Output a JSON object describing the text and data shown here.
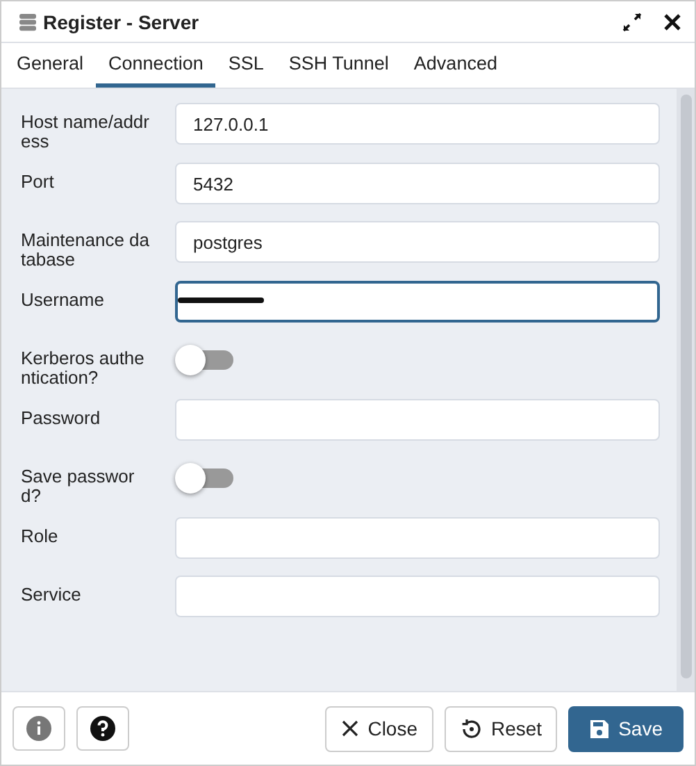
{
  "window": {
    "title": "Register - Server"
  },
  "tabs": [
    {
      "label": "General",
      "selected": false
    },
    {
      "label": "Connection",
      "selected": true
    },
    {
      "label": "SSL",
      "selected": false
    },
    {
      "label": "SSH Tunnel",
      "selected": false
    },
    {
      "label": "Advanced",
      "selected": false
    }
  ],
  "fields": [
    {
      "kind": "text",
      "label": "Host name/address",
      "value": "127.0.0.1",
      "focused": false
    },
    {
      "kind": "text",
      "label": "Port",
      "value": "5432",
      "focused": false
    },
    {
      "kind": "text",
      "label": "Maintenance database",
      "value": "postgres",
      "focused": false
    },
    {
      "kind": "text",
      "label": "Username",
      "focused": true,
      "redacted": true
    },
    {
      "kind": "toggle",
      "label": "Kerberos authentication?",
      "on": false
    },
    {
      "kind": "text",
      "label": "Password",
      "focused": false
    },
    {
      "kind": "toggle",
      "label": "Save password?",
      "on": false
    },
    {
      "kind": "text",
      "label": "Role",
      "focused": false
    },
    {
      "kind": "text",
      "label": "Service",
      "focused": false
    }
  ],
  "buttons": [
    {
      "kind": "close",
      "label": "Close"
    },
    {
      "kind": "reset",
      "label": "Reset"
    },
    {
      "kind": "save",
      "label": "Save"
    }
  ]
}
